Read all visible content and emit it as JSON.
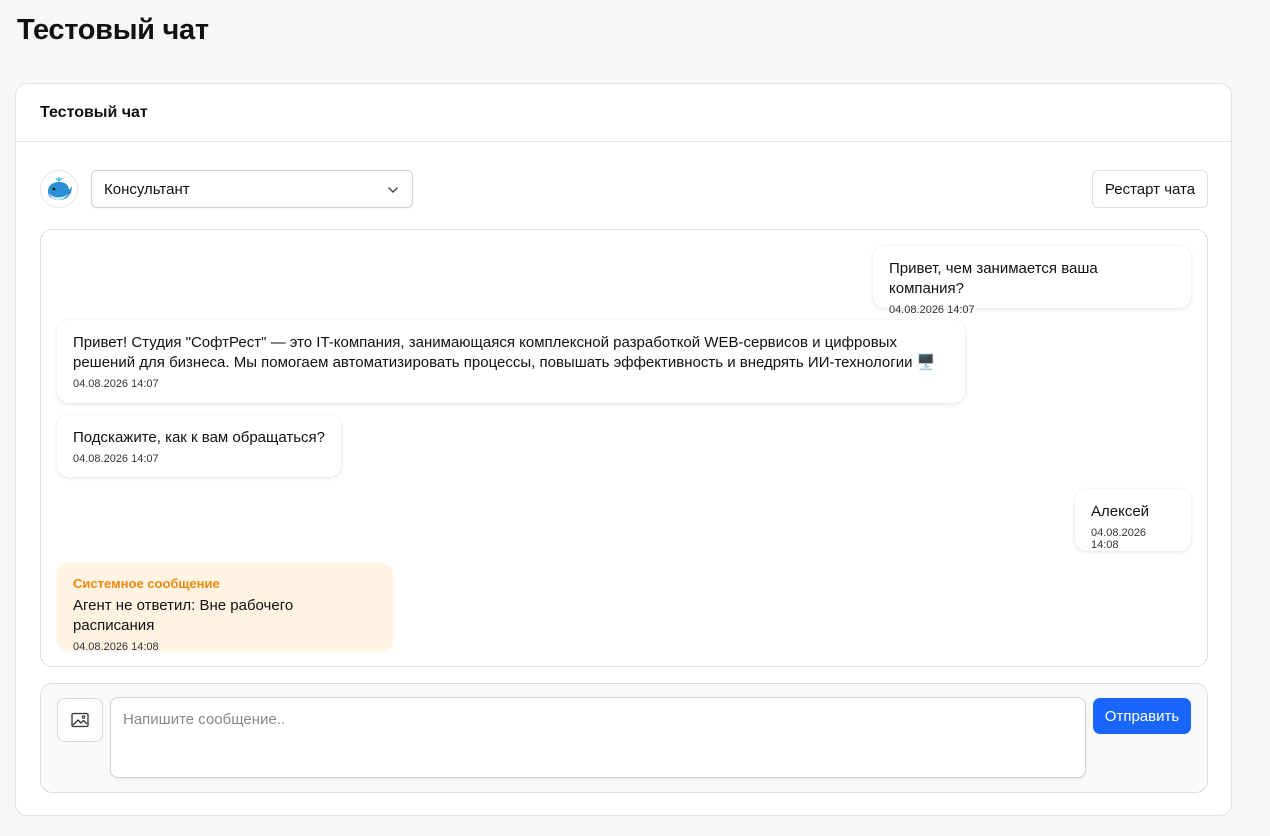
{
  "page": {
    "title": "Тестовый чат"
  },
  "card": {
    "title": "Тестовый чат"
  },
  "toolbar": {
    "agent_avatar_icon": "whale-icon",
    "agent_select_value": "Консультант",
    "restart_label": "Рестарт чата"
  },
  "messages": [
    {
      "side": "right",
      "type": "user",
      "text": "Привет, чем занимается ваша компания?",
      "time": "04.08.2026 14:07"
    },
    {
      "side": "left",
      "type": "agent",
      "text": "Привет! Студия \"СофтРест\" — это IT-компания, занимающаяся комплексной разработкой WEB-сервисов и цифровых решений для бизнеса. Мы помогаем автоматизировать процессы, повышать эффективность и внедрять ИИ-технологии 🖥️",
      "time": "04.08.2026 14:07"
    },
    {
      "side": "left",
      "type": "agent",
      "text": "Подскажите, как к вам обращаться?",
      "time": "04.08.2026 14:07"
    },
    {
      "side": "right",
      "type": "user",
      "text": "Алексей",
      "time": "04.08.2026 14:08"
    },
    {
      "side": "left",
      "type": "system",
      "label": "Системное сообщение",
      "text": "Агент не ответил: Вне рабочего расписания",
      "time": "04.08.2026 14:08"
    }
  ],
  "composer": {
    "attach_icon": "image-icon",
    "placeholder": "Напишите сообщение..",
    "send_label": "Отправить"
  },
  "colors": {
    "accent": "#1966ff",
    "system_label": "#ec8a12",
    "system_bg": "#fff3e2"
  }
}
